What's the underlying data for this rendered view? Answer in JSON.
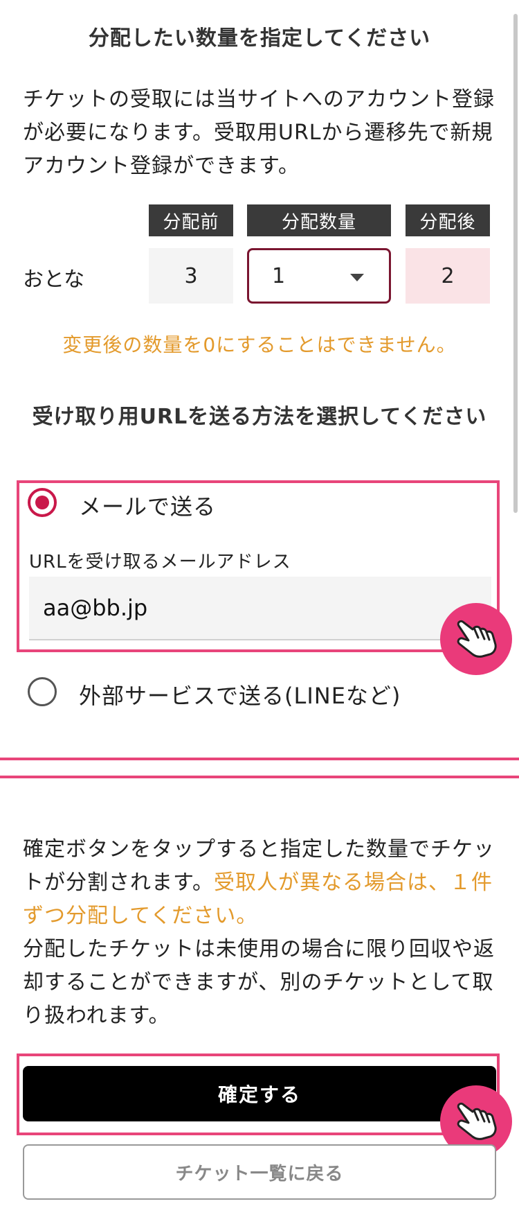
{
  "title": "分配したい数量を指定してください",
  "intro": "チケットの受取には当サイトへのアカウント登録が必要になります。受取用URLから遷移先で新規アカウント登録ができます。",
  "table": {
    "headers": {
      "before": "分配前",
      "qty": "分配数量",
      "after": "分配後"
    },
    "row_label": "おとな",
    "before": "3",
    "qty": "1",
    "after": "2"
  },
  "warning": "変更後の数量を0にすることはできません。",
  "send_method": {
    "title": "受け取り用URLを送る方法を選択してください",
    "mail_option": "メールで送る",
    "email_label": "URLを受け取るメールアドレス",
    "email_value": "aa@bb.jp",
    "external_option": "外部サービスで送る(LINEなど)"
  },
  "notice": {
    "part1": "確定ボタンをタップすると指定した数量でチケットが分割されます。",
    "highlight": "受取人が異なる場合は、１件ずつ分配してください。",
    "part2": "分配したチケットは未使用の場合に限り回収や返却することができますが、別のチケットとして取り扱われます。"
  },
  "buttons": {
    "confirm": "確定する",
    "back": "チケット一覧に戻る"
  },
  "colors": {
    "accent": "#c9184a",
    "highlight_border": "#e8457a",
    "warning": "#e39a2c",
    "header_bg": "#3a3a3a",
    "after_bg": "#fae3e6"
  },
  "icons": {
    "tap": "tap-hand-icon",
    "dropdown": "caret-down-icon"
  }
}
